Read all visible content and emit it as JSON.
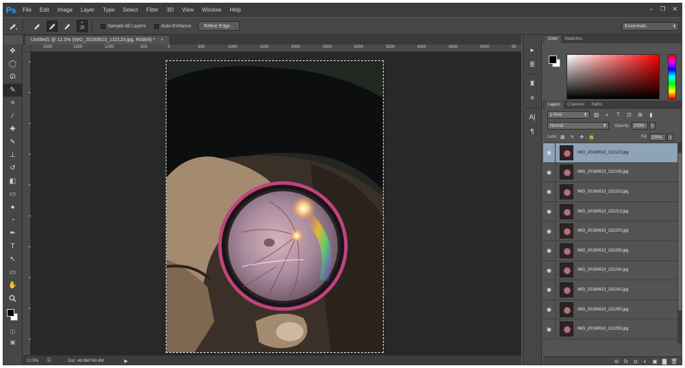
{
  "app": {
    "logo": "Ps",
    "window_controls": [
      "–",
      "❐",
      "✕"
    ]
  },
  "menu": [
    "File",
    "Edit",
    "Image",
    "Layer",
    "Type",
    "Select",
    "Filter",
    "3D",
    "View",
    "Window",
    "Help"
  ],
  "options": {
    "brush_size": "25",
    "sample_all_layers": "Sample All Layers",
    "auto_enhance": "Auto-Enhance",
    "refine_edge": "Refine Edge...",
    "workspace": "Essentials"
  },
  "document": {
    "tab_title": "Untitled1 @ 12.5% (IMG_20160613_132123.jpg, RGB/8) *",
    "tab_close": "×"
  },
  "ruler": {
    "labels": [
      "2000",
      "1500",
      "1000",
      "500",
      "0",
      "500",
      "1000",
      "1500",
      "2000",
      "2500",
      "3000",
      "3500",
      "4000",
      "4500",
      "5000",
      "55"
    ]
  },
  "status": {
    "zoom": "12.5%",
    "doc": "Doc: 46.8M/749.4M",
    "arrow": "▶"
  },
  "icons": {
    "move": "✥",
    "marquee": "◯",
    "lasso": "ᘏ",
    "quick_select": "✎",
    "crop": "⌗",
    "eyedropper": "⁄",
    "healing": "✚",
    "brush": "✎",
    "stamp": "⊥",
    "history": "↺",
    "eraser": "◧",
    "gradient": "▭",
    "blur": "●",
    "dodge": "◔",
    "pen": "✒",
    "type": "T",
    "path_select": "↖",
    "shape": "▭",
    "hand": "✋",
    "zoom": "🔍",
    "swap": "⇄",
    "quick_mask": "◫",
    "screen_mode": "▣"
  },
  "strip_icons": [
    "▸",
    "≣",
    "♜",
    "≡",
    "A|",
    "¶"
  ],
  "color_panel": {
    "tabs": [
      "Color",
      "Swatches"
    ]
  },
  "layers_panel": {
    "tabs": [
      "Layers",
      "Channels",
      "Paths"
    ],
    "kind": "ρ Kind",
    "blend_mode": "Normal",
    "opacity_label": "Opacity:",
    "opacity_value": "100%",
    "lock_label": "Lock:",
    "fill_label": "Fill:",
    "fill_value": "100%",
    "layers": [
      {
        "name": "IMG_20160613_132123.jpg",
        "selected": true
      },
      {
        "name": "IMG_20160613_132145.jpg",
        "selected": false
      },
      {
        "name": "IMG_20160613_132153.jpg",
        "selected": false
      },
      {
        "name": "IMG_20160613_132213.jpg",
        "selected": false
      },
      {
        "name": "IMG_20160613_132220.jpg",
        "selected": false
      },
      {
        "name": "IMG_20160613_132230.jpg",
        "selected": false
      },
      {
        "name": "IMG_20160613_132234.jpg",
        "selected": false
      },
      {
        "name": "IMG_20160613_132241.jpg",
        "selected": false
      },
      {
        "name": "IMG_20160613_132250.jpg",
        "selected": false
      },
      {
        "name": "IMG_20160613_132255.jpg",
        "selected": false
      }
    ],
    "footer_icons": [
      "⊖",
      "fx",
      "◘",
      "◐",
      "▣",
      "▇",
      "🗑"
    ]
  }
}
